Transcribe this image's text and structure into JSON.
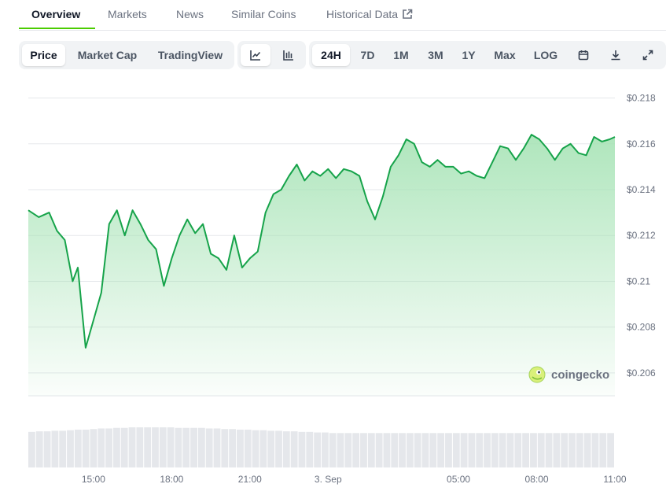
{
  "tabs": [
    {
      "label": "Overview",
      "active": true
    },
    {
      "label": "Markets"
    },
    {
      "label": "News"
    },
    {
      "label": "Similar Coins"
    },
    {
      "label": "Historical Data",
      "external_link": true
    }
  ],
  "toolbar": {
    "chart_modes": [
      {
        "label": "Price",
        "selected": true
      },
      {
        "label": "Market Cap"
      },
      {
        "label": "TradingView"
      }
    ],
    "chart_styles": [
      {
        "icon": "line-chart-icon",
        "selected": true
      },
      {
        "icon": "candlestick-chart-icon"
      }
    ],
    "ranges": [
      {
        "label": "24H",
        "selected": true
      },
      {
        "label": "7D"
      },
      {
        "label": "1M"
      },
      {
        "label": "3M"
      },
      {
        "label": "1Y"
      },
      {
        "label": "Max"
      },
      {
        "label": "LOG"
      }
    ],
    "action_icons": [
      "calendar-icon",
      "download-icon",
      "fullscreen-icon"
    ]
  },
  "watermark": {
    "text": "coingecko",
    "icon": "coingecko-logo-icon"
  },
  "colors": {
    "line": "#16a34a",
    "fill_top": "#a6e3b5",
    "accent": "#4bcc00",
    "volume": "#e5e7eb"
  },
  "chart_data": {
    "type": "area",
    "ylim": [
      0.205,
      0.2185
    ],
    "yticks": [
      {
        "value": 0.218,
        "label": "$0.218"
      },
      {
        "value": 0.216,
        "label": "$0.216"
      },
      {
        "value": 0.214,
        "label": "$0.214"
      },
      {
        "value": 0.212,
        "label": "$0.212"
      },
      {
        "value": 0.21,
        "label": "$0.21"
      },
      {
        "value": 0.208,
        "label": "$0.208"
      },
      {
        "value": 0.206,
        "label": "$0.206"
      }
    ],
    "xlim": [
      12.5,
      35.0
    ],
    "xticks": [
      {
        "hours": 15,
        "label": "15:00"
      },
      {
        "hours": 18,
        "label": "18:00"
      },
      {
        "hours": 21,
        "label": "21:00"
      },
      {
        "hours": 24,
        "label": "3. Sep"
      },
      {
        "hours": 29,
        "label": "05:00"
      },
      {
        "hours": 32,
        "label": "08:00"
      },
      {
        "hours": 35,
        "label": "11:00"
      }
    ],
    "x_hours": [
      12.5,
      12.9,
      13.3,
      13.6,
      13.9,
      14.2,
      14.4,
      14.7,
      15.0,
      15.3,
      15.6,
      15.9,
      16.2,
      16.5,
      16.8,
      17.1,
      17.4,
      17.7,
      18.0,
      18.3,
      18.6,
      18.9,
      19.2,
      19.5,
      19.8,
      20.1,
      20.4,
      20.7,
      21.0,
      21.3,
      21.6,
      21.9,
      22.2,
      22.5,
      22.8,
      23.1,
      23.4,
      23.7,
      24.0,
      24.3,
      24.6,
      24.9,
      25.2,
      25.5,
      25.8,
      26.1,
      26.4,
      26.7,
      27.0,
      27.3,
      27.6,
      27.9,
      28.2,
      28.5,
      28.8,
      29.1,
      29.4,
      29.7,
      30.0,
      30.3,
      30.6,
      30.9,
      31.2,
      31.5,
      31.8,
      32.1,
      32.4,
      32.7,
      33.0,
      33.3,
      33.6,
      33.9,
      34.2,
      34.5,
      34.8,
      35.0
    ],
    "price": [
      0.2131,
      0.2128,
      0.213,
      0.2122,
      0.2118,
      0.21,
      0.2106,
      0.2071,
      0.2083,
      0.2095,
      0.2125,
      0.2131,
      0.212,
      0.2131,
      0.2125,
      0.2118,
      0.2114,
      0.2098,
      0.211,
      0.212,
      0.2127,
      0.2121,
      0.2125,
      0.2112,
      0.211,
      0.2105,
      0.212,
      0.2106,
      0.211,
      0.2113,
      0.213,
      0.2138,
      0.214,
      0.2146,
      0.2151,
      0.2144,
      0.2148,
      0.2146,
      0.2149,
      0.2145,
      0.2149,
      0.2148,
      0.2146,
      0.2135,
      0.2127,
      0.2137,
      0.215,
      0.2155,
      0.2162,
      0.216,
      0.2152,
      0.215,
      0.2153,
      0.215,
      0.215,
      0.2147,
      0.2148,
      0.2146,
      0.2145,
      0.2152,
      0.2159,
      0.2158,
      0.2153,
      0.2158,
      0.2164,
      0.2162,
      0.2158,
      0.2153,
      0.2158,
      0.216,
      0.2156,
      0.2155,
      0.2163,
      0.2161,
      0.2162,
      0.2163
    ],
    "volume": [
      0.62,
      0.63,
      0.63,
      0.64,
      0.64,
      0.65,
      0.66,
      0.66,
      0.67,
      0.68,
      0.68,
      0.69,
      0.69,
      0.7,
      0.7,
      0.7,
      0.7,
      0.7,
      0.7,
      0.69,
      0.69,
      0.69,
      0.69,
      0.68,
      0.68,
      0.67,
      0.67,
      0.66,
      0.66,
      0.65,
      0.65,
      0.64,
      0.64,
      0.63,
      0.63,
      0.62,
      0.62,
      0.61,
      0.61,
      0.6,
      0.6,
      0.6,
      0.6,
      0.6,
      0.6,
      0.6,
      0.6,
      0.6,
      0.6,
      0.6,
      0.6,
      0.6,
      0.6,
      0.6,
      0.6,
      0.6,
      0.6,
      0.6,
      0.6,
      0.6,
      0.6,
      0.6,
      0.6,
      0.6,
      0.6,
      0.6,
      0.6,
      0.6,
      0.6,
      0.6,
      0.6,
      0.6,
      0.6,
      0.6,
      0.6,
      0.6
    ]
  }
}
